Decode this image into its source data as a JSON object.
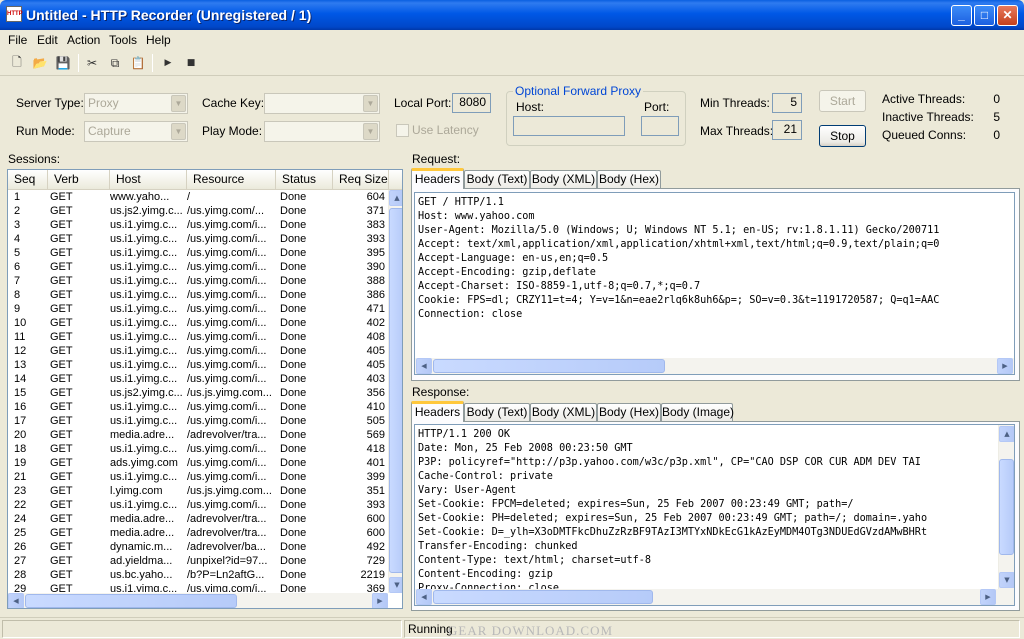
{
  "window": {
    "title": "Untitled - HTTP Recorder (Unregistered / 1)",
    "app_icon_text": "HTTP",
    "minimize_glyph": "_",
    "maximize_glyph": "□",
    "close_glyph": "✕"
  },
  "menu": [
    "File",
    "Edit",
    "Action",
    "Tools",
    "Help"
  ],
  "toolbar": {
    "icons": [
      "new-icon",
      "open-icon",
      "save-icon",
      "cut-icon",
      "copy-icon",
      "paste-icon",
      "play-icon",
      "stop-icon"
    ],
    "glyphs": {
      "new": "🗋",
      "open": "📂",
      "save": "💾",
      "cut": "✂",
      "copy": "⧉",
      "paste": "📋",
      "play": "▶",
      "stop": "■"
    }
  },
  "settings": {
    "server_type_label": "Server Type:",
    "server_type_value": "Proxy",
    "run_mode_label": "Run Mode:",
    "run_mode_value": "Capture",
    "cache_key_label": "Cache Key:",
    "cache_key_value": "",
    "play_mode_label": "Play Mode:",
    "play_mode_value": "",
    "local_port_label": "Local Port:",
    "local_port_value": "8080",
    "use_latency_label": "Use Latency",
    "use_latency_checked": false,
    "proxy_group_title": "Optional Forward Proxy",
    "proxy_host_label": "Host:",
    "proxy_host_value": "",
    "proxy_port_label": "Port:",
    "proxy_port_value": "",
    "min_threads_label": "Min Threads:",
    "min_threads_value": "5",
    "max_threads_label": "Max Threads:",
    "max_threads_value": "21",
    "start_label": "Start",
    "stop_label": "Stop",
    "active_threads_label": "Active Threads:",
    "active_threads_value": "0",
    "inactive_threads_label": "Inactive Threads:",
    "inactive_threads_value": "5",
    "queued_conns_label": "Queued Conns:",
    "queued_conns_value": "0"
  },
  "sessions": {
    "label": "Sessions:",
    "columns": [
      "Seq",
      "Verb",
      "Host",
      "Resource",
      "Status",
      "Req Size"
    ],
    "rows": [
      [
        "1",
        "GET",
        "www.yaho...",
        "/",
        "Done",
        "604"
      ],
      [
        "2",
        "GET",
        "us.js2.yimg.c...",
        "/us.yimg.com/...",
        "Done",
        "371"
      ],
      [
        "3",
        "GET",
        "us.i1.yimg.c...",
        "/us.yimg.com/i...",
        "Done",
        "383"
      ],
      [
        "4",
        "GET",
        "us.i1.yimg.c...",
        "/us.yimg.com/i...",
        "Done",
        "393"
      ],
      [
        "5",
        "GET",
        "us.i1.yimg.c...",
        "/us.yimg.com/i...",
        "Done",
        "395"
      ],
      [
        "6",
        "GET",
        "us.i1.yimg.c...",
        "/us.yimg.com/i...",
        "Done",
        "390"
      ],
      [
        "7",
        "GET",
        "us.i1.yimg.c...",
        "/us.yimg.com/i...",
        "Done",
        "388"
      ],
      [
        "8",
        "GET",
        "us.i1.yimg.c...",
        "/us.yimg.com/i...",
        "Done",
        "386"
      ],
      [
        "9",
        "GET",
        "us.i1.yimg.c...",
        "/us.yimg.com/i...",
        "Done",
        "471"
      ],
      [
        "10",
        "GET",
        "us.i1.yimg.c...",
        "/us.yimg.com/i...",
        "Done",
        "402"
      ],
      [
        "11",
        "GET",
        "us.i1.yimg.c...",
        "/us.yimg.com/i...",
        "Done",
        "408"
      ],
      [
        "12",
        "GET",
        "us.i1.yimg.c...",
        "/us.yimg.com/i...",
        "Done",
        "405"
      ],
      [
        "13",
        "GET",
        "us.i1.yimg.c...",
        "/us.yimg.com/i...",
        "Done",
        "405"
      ],
      [
        "14",
        "GET",
        "us.i1.yimg.c...",
        "/us.yimg.com/i...",
        "Done",
        "403"
      ],
      [
        "15",
        "GET",
        "us.js2.yimg.c...",
        "/us.js.yimg.com...",
        "Done",
        "356"
      ],
      [
        "16",
        "GET",
        "us.i1.yimg.c...",
        "/us.yimg.com/i...",
        "Done",
        "410"
      ],
      [
        "17",
        "GET",
        "us.i1.yimg.c...",
        "/us.yimg.com/i...",
        "Done",
        "505"
      ],
      [
        "20",
        "GET",
        "media.adre...",
        "/adrevolver/tra...",
        "Done",
        "569"
      ],
      [
        "18",
        "GET",
        "us.i1.yimg.c...",
        "/us.yimg.com/i...",
        "Done",
        "418"
      ],
      [
        "19",
        "GET",
        "ads.yimg.com",
        "/us.yimg.com/i...",
        "Done",
        "401"
      ],
      [
        "21",
        "GET",
        "us.i1.yimg.c...",
        "/us.yimg.com/i...",
        "Done",
        "399"
      ],
      [
        "23",
        "GET",
        "l.yimg.com",
        "/us.js.yimg.com...",
        "Done",
        "351"
      ],
      [
        "22",
        "GET",
        "us.i1.yimg.c...",
        "/us.yimg.com/i...",
        "Done",
        "393"
      ],
      [
        "24",
        "GET",
        "media.adre...",
        "/adrevolver/tra...",
        "Done",
        "600"
      ],
      [
        "25",
        "GET",
        "media.adre...",
        "/adrevolver/tra...",
        "Done",
        "600"
      ],
      [
        "26",
        "GET",
        "dynamic.m...",
        "/adrevolver/ba...",
        "Done",
        "492"
      ],
      [
        "27",
        "GET",
        "ad.yieldma...",
        "/unpixel?id=97...",
        "Done",
        "729"
      ],
      [
        "28",
        "GET",
        "us.bc.yaho...",
        "/b?P=Ln2aftG...",
        "Done",
        "2219"
      ],
      [
        "29",
        "GET",
        "us.i1.yimg.c...",
        "/us.yimg.com/i...",
        "Done",
        "369"
      ]
    ]
  },
  "request": {
    "label": "Request:",
    "tabs": [
      "Headers",
      "Body (Text)",
      "Body (XML)",
      "Body (Hex)"
    ],
    "active_tab": "Headers",
    "body": "GET / HTTP/1.1\nHost: www.yahoo.com\nUser-Agent: Mozilla/5.0 (Windows; U; Windows NT 5.1; en-US; rv:1.8.1.11) Gecko/200711\nAccept: text/xml,application/xml,application/xhtml+xml,text/html;q=0.9,text/plain;q=0\nAccept-Language: en-us,en;q=0.5\nAccept-Encoding: gzip,deflate\nAccept-Charset: ISO-8859-1,utf-8;q=0.7,*;q=0.7\nCookie: FPS=dl; CRZY11=t=4; Y=v=1&n=eae2rlq6k8uh6&p=; SO=v=0.3&t=1191720587; Q=q1=AAC\nConnection: close"
  },
  "response": {
    "label": "Response:",
    "tabs": [
      "Headers",
      "Body (Text)",
      "Body (XML)",
      "Body (Hex)",
      "Body (Image)"
    ],
    "active_tab": "Headers",
    "body": "HTTP/1.1 200 OK\nDate: Mon, 25 Feb 2008 00:23:50 GMT\nP3P: policyref=\"http://p3p.yahoo.com/w3c/p3p.xml\", CP=\"CAO DSP COR CUR ADM DEV TAI\nCache-Control: private\nVary: User-Agent\nSet-Cookie: FPCM=deleted; expires=Sun, 25 Feb 2007 00:23:49 GMT; path=/\nSet-Cookie: PH=deleted; expires=Sun, 25 Feb 2007 00:23:49 GMT; path=/; domain=.yaho\nSet-Cookie: D=_ylh=X3oDMTFkcDhuZzRzBF9TAzI3MTYxNDkEcG1kAzEyMDM4OTg3NDUEdGVzdAMwBHRt\nTransfer-Encoding: chunked\nContent-Type: text/html; charset=utf-8\nContent-Encoding: gzip\nProxy-Connection: close"
  },
  "status": {
    "text": "Running",
    "watermark": "GEAR DOWNLOAD.COM"
  }
}
